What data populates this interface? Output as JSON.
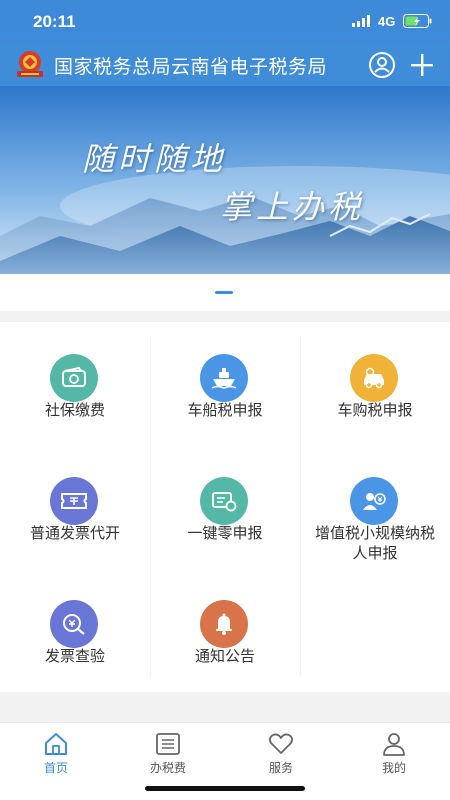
{
  "status_bar": {
    "time": "20:11",
    "network": "4G"
  },
  "header": {
    "title": "国家税务总局云南省电子税务局",
    "user_icon": "user-circle-icon",
    "add_icon": "plus-icon"
  },
  "banner": {
    "line1": "随时随地",
    "line2": "掌上办税"
  },
  "services": [
    {
      "label": "社保缴费",
      "icon": "wallet-icon",
      "color": "#55b8a6"
    },
    {
      "label": "车船税申报",
      "icon": "ship-icon",
      "color": "#4b95e6"
    },
    {
      "label": "车购税申报",
      "icon": "car-icon",
      "color": "#f0b338"
    },
    {
      "label": "普通发票代开",
      "icon": "invoice-ticket-icon",
      "color": "#6a76d6"
    },
    {
      "label": "一键零申报",
      "icon": "zero-declare-icon",
      "color": "#55b8a6"
    },
    {
      "label": "增值税小规模纳税人申报",
      "icon": "taxpayer-icon",
      "color": "#4b95e6"
    },
    {
      "label": "发票查验",
      "icon": "invoice-check-icon",
      "color": "#6a76d6"
    },
    {
      "label": "通知公告",
      "icon": "bell-icon",
      "color": "#d9744a"
    }
  ],
  "tabbar": [
    {
      "label": "首页",
      "icon": "home-icon",
      "active": true
    },
    {
      "label": "办税费",
      "icon": "list-icon",
      "active": false
    },
    {
      "label": "服务",
      "icon": "heart-icon",
      "active": false
    },
    {
      "label": "我的",
      "icon": "person-icon",
      "active": false
    }
  ],
  "colors": {
    "brand": "#3f8cd9",
    "text": "#333333"
  }
}
